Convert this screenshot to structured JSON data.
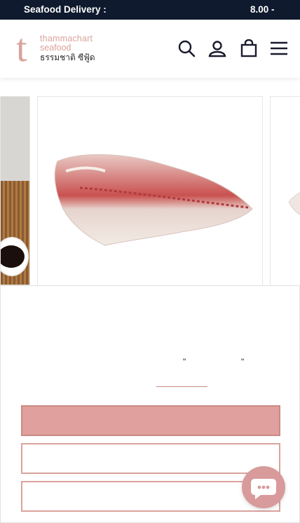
{
  "announcement": {
    "left_text": "Seafood Delivery :",
    "right_text": "8.00 -"
  },
  "header": {
    "logo": {
      "letter": "t",
      "line1": "thammachart",
      "line2": "seafood",
      "line3": "ธรรมชาติ ซีฟู้ด"
    },
    "icons": [
      "search-icon",
      "account-icon",
      "cart-icon",
      "menu-icon"
    ]
  },
  "modal": {
    "quote_open": "\"",
    "quote_close": "\""
  },
  "colors": {
    "topbar": "#0f1a2e",
    "brand": "#d9a39c",
    "primary_button": "#dfa09e",
    "chat": "#d99a9c"
  }
}
